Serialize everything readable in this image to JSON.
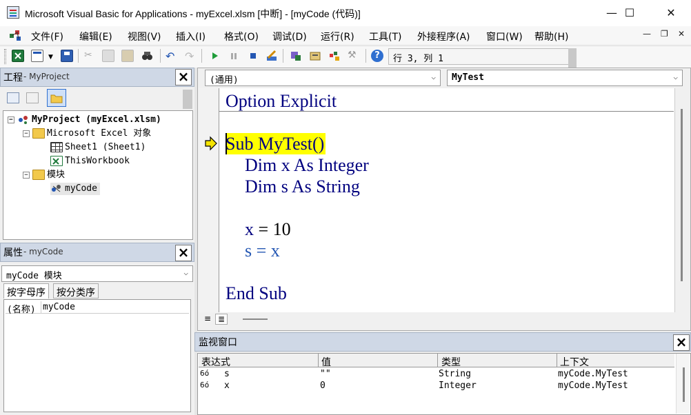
{
  "window": {
    "title": "Microsoft Visual Basic for Applications - myExcel.xlsm [中断] - [myCode (代码)]",
    "minimize_glyph": "—",
    "maximize_glyph": "☐",
    "close_glyph": "✕"
  },
  "menu": {
    "items": [
      "文件(F)",
      "编辑(E)",
      "视图(V)",
      "插入(I)",
      "格式(O)",
      "调试(D)",
      "运行(R)",
      "工具(T)",
      "外接程序(A)",
      "窗口(W)",
      "帮助(H)"
    ],
    "mdi_minimize": "—",
    "mdi_restore": "❐",
    "mdi_close": "✕"
  },
  "toolbar": {
    "position": "行 3, 列 1",
    "icons": [
      "excel-icon",
      "insert-userform-icon",
      "save-icon",
      "cut-icon",
      "copy-icon",
      "paste-icon",
      "find-icon",
      "undo-icon",
      "redo-icon",
      "run-icon",
      "break-icon",
      "reset-icon",
      "design-mode-icon",
      "project-explorer-icon",
      "properties-window-icon",
      "object-browser-icon",
      "toolbox-icon",
      "help-icon"
    ]
  },
  "project": {
    "title": "工程",
    "subtitle": " - MyProject",
    "tree": {
      "root": "MyProject (myExcel.xlsm)",
      "folder_objects": "Microsoft Excel 对象",
      "sheet1": "Sheet1 (Sheet1)",
      "thisworkbook": "ThisWorkbook",
      "folder_modules": "模块",
      "module": "myCode"
    }
  },
  "properties": {
    "title": "属性",
    "subtitle": " - myCode",
    "object_select": "myCode 模块",
    "tab_alpha": "按字母序",
    "tab_category": "按分类序",
    "row_name_label": "(名称)",
    "row_name_value": "myCode"
  },
  "code": {
    "object_dropdown": "(通用)",
    "procedure_dropdown": "MyTest",
    "line1": "Option Explicit",
    "line2": "Sub MyTest()",
    "line3": "Dim x As Integer",
    "line4": "Dim s As String",
    "line5a": "x",
    "line5b": " = 10",
    "line6a": "s",
    "line6b": " = ",
    "line6c": "x",
    "line7": "End Sub",
    "highlight_color": "#ffff00"
  },
  "watch": {
    "title": "监视窗口",
    "headers": [
      "表达式",
      "值",
      "类型",
      "上下文"
    ],
    "rows": [
      {
        "expr": "s",
        "value": "\"\"",
        "type": "String",
        "context": "myCode.MyTest"
      },
      {
        "expr": "x",
        "value": "0",
        "type": "Integer",
        "context": "myCode.MyTest"
      }
    ],
    "glasses_glyph": "6ó"
  }
}
